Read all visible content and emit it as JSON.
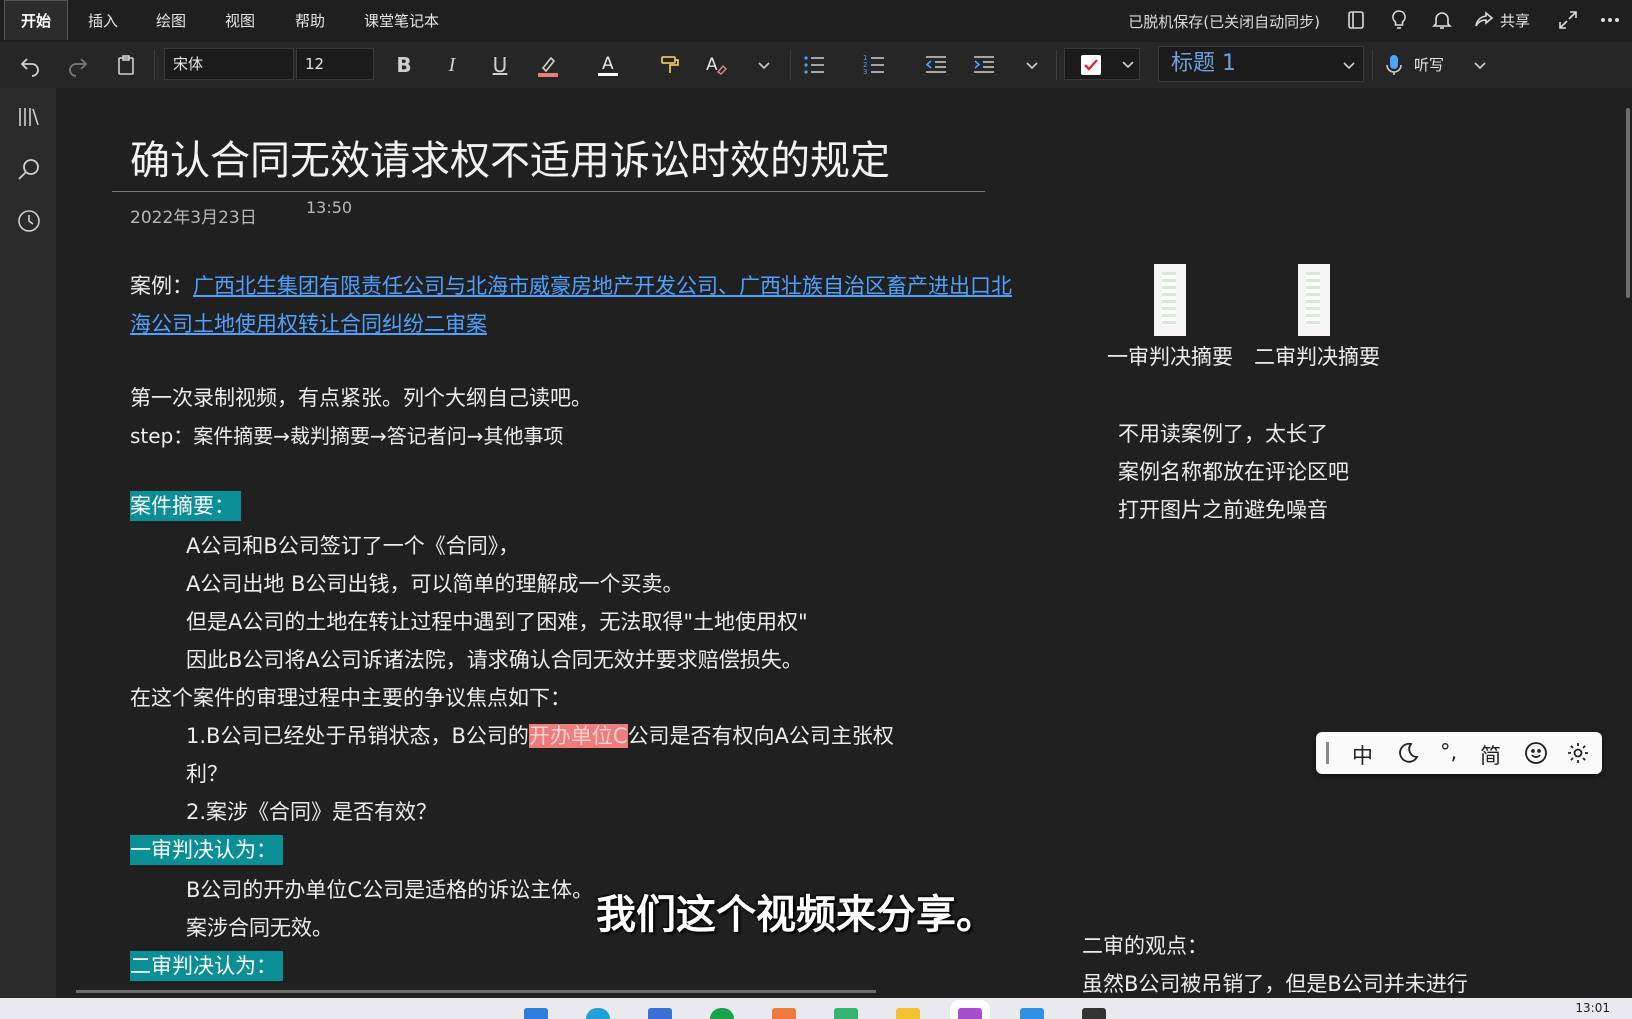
{
  "menu": {
    "tabs": [
      "开始",
      "插入",
      "绘图",
      "视图",
      "帮助",
      "课堂笔记本"
    ],
    "status": "已脱机保存(已关闭自动同步)",
    "share": "共享"
  },
  "toolbar": {
    "font_name": "宋体",
    "font_size": "12",
    "style": "标题 1",
    "dictate": "听写"
  },
  "page": {
    "title": "确认合同无效请求权不适用诉讼时效的规定",
    "date": "2022年3月23日",
    "time": "13:50",
    "case_prefix": "案例：",
    "case_link_1": "广西北生集团有限责任公司与北海市威豪房地产开发公司、广西壮族自治区畜产进出口北",
    "case_link_2": "海公司土地使用权转让合同纠纷二审案",
    "intro": "第一次录制视频，有点紧张。列个大纲自己读吧。",
    "step": "step：案件摘要→裁判摘要→答记者问→其他事项",
    "summary_heading": "案件摘要：",
    "summary_lines": [
      "A公司和B公司签订了一个《合同》，",
      "A公司出地 B公司出钱，可以简单的理解成一个买卖。",
      "但是A公司的土地在转让过程中遇到了困难，无法取得\"土地使用权\"",
      "因此B公司将A公司诉诸法院，请求确认合同无效并要求赔偿损失。"
    ],
    "dispute_intro": "在这个案件的审理过程中主要的争议焦点如下：",
    "dispute_1_pre": "1.B公司已经处于吊销状态，B公司的",
    "dispute_1_hl": "开办单位C",
    "dispute_1_post": "公司是否有权向A公司主张权",
    "dispute_1_cont": "利？",
    "dispute_2": "2.案涉《合同》是否有效？",
    "first_heading": "一审判决认为：",
    "first_lines": [
      "B公司的开办单位C公司是适格的诉讼主体。",
      "案涉合同无效。"
    ],
    "second_heading": "二审判决认为：",
    "thumb_1": "一审判决摘要",
    "thumb_2": "二审判决摘要",
    "side_notes": [
      "不用读案例了，太长了",
      "案例名称都放在评论区吧",
      "打开图片之前避免噪音"
    ],
    "second_view_heading": "二审的观点：",
    "second_view_line": "虽然B公司被吊销了，但是B公司并未进行"
  },
  "ime": {
    "mode": "中",
    "script": "简"
  },
  "subtitle": "我们这个视频来分享。",
  "taskbar": {
    "clock": "13:01"
  },
  "colors": {
    "link": "#4ea1ff",
    "teal_highlight": "#0b8f97",
    "pink_highlight": "#f07b7b",
    "style_blue": "#6ca0dc"
  }
}
